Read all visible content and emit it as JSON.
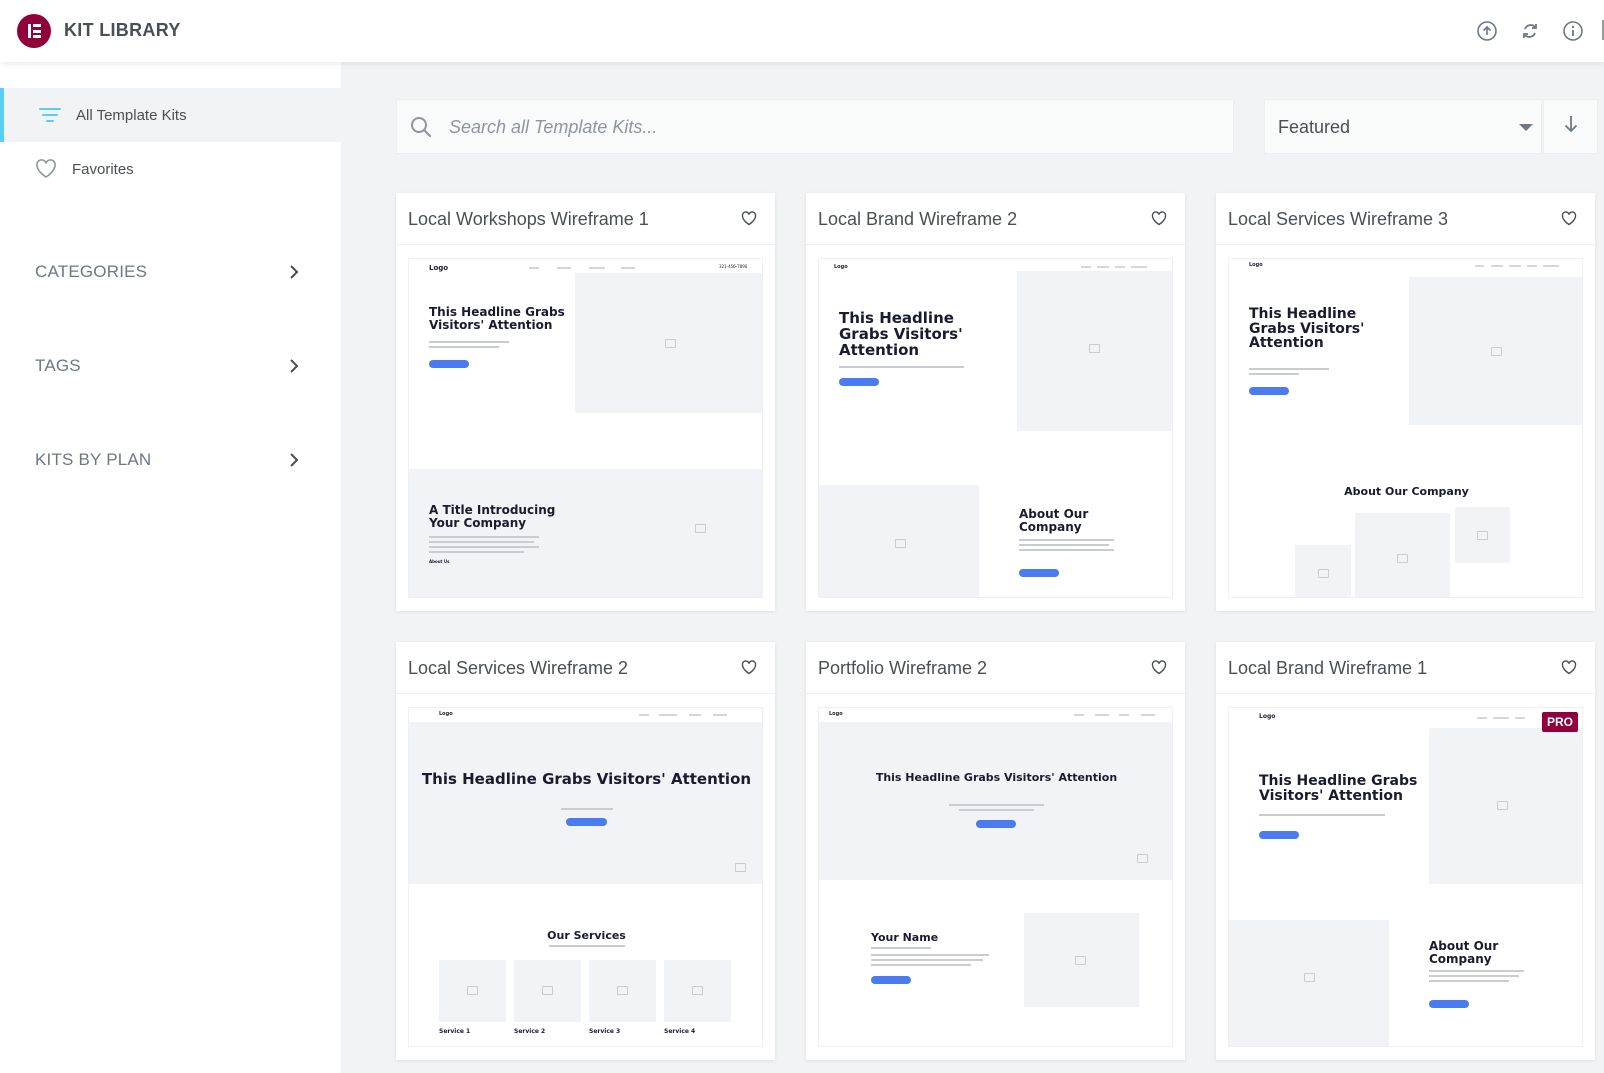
{
  "header": {
    "title": "KIT LIBRARY",
    "icons": [
      "upload-icon",
      "refresh-icon",
      "info-icon"
    ]
  },
  "sidebar": {
    "items": [
      {
        "label": "All Template Kits",
        "icon": "filter-lines-icon",
        "active": true
      },
      {
        "label": "Favorites",
        "icon": "heart-icon",
        "active": false
      }
    ],
    "sections": [
      {
        "label": "CATEGORIES"
      },
      {
        "label": "TAGS"
      },
      {
        "label": "KITS BY PLAN"
      }
    ]
  },
  "search": {
    "placeholder": "Search all Template Kits...",
    "value": ""
  },
  "sort": {
    "selected": "Featured",
    "direction": "descending"
  },
  "colors": {
    "brand": "#92003b",
    "accent": "#58d0f5",
    "button": "#4a7bf0"
  },
  "cards": [
    {
      "title": "Local Workshops Wireframe 1",
      "pro": false,
      "thumb": {
        "logo": "Logo",
        "phone": "321-456-7890",
        "headline": "This Headline Grabs Visitors' Attention",
        "section_title": "A Title Introducing Your Company",
        "link": "About Us"
      }
    },
    {
      "title": "Local Brand Wireframe 2",
      "pro": false,
      "thumb": {
        "logo": "Logo",
        "headline": "This Headline Grabs Visitors' Attention",
        "section_title": "About Our Company"
      }
    },
    {
      "title": "Local Services Wireframe 3",
      "pro": false,
      "thumb": {
        "logo": "Logo",
        "headline": "This Headline Grabs Visitors' Attention",
        "section_title": "About Our Company"
      }
    },
    {
      "title": "Local Services Wireframe 2",
      "pro": false,
      "thumb": {
        "logo": "Logo",
        "headline": "This Headline Grabs Visitors' Attention",
        "section_title": "Our Services",
        "services": [
          "Service 1",
          "Service 2",
          "Service 3",
          "Service 4"
        ]
      }
    },
    {
      "title": "Portfolio Wireframe 2",
      "pro": false,
      "thumb": {
        "logo": "Logo",
        "headline": "This Headline Grabs Visitors' Attention",
        "section_title": "Your Name"
      }
    },
    {
      "title": "Local Brand Wireframe 1",
      "pro": true,
      "pro_label": "PRO",
      "thumb": {
        "logo": "Logo",
        "headline": "This Headline Grabs Visitors' Attention",
        "section_title": "About Our Company"
      }
    }
  ]
}
